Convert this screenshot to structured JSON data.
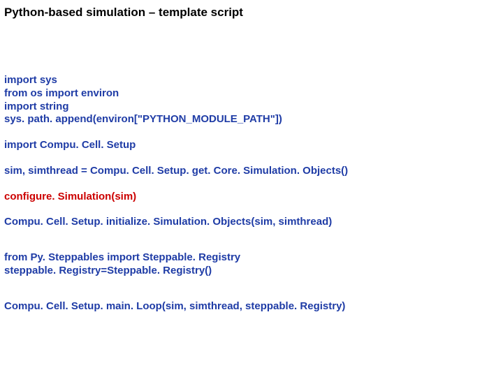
{
  "title": "Python-based simulation – template script",
  "code": {
    "l1": "import sys",
    "l2": "from os import environ",
    "l3": "import string",
    "l4": "sys. path. append(environ[\"PYTHON_MODULE_PATH\"])",
    "l5": "import Compu. Cell. Setup",
    "l6": "sim, simthread = Compu. Cell. Setup. get. Core. Simulation. Objects()",
    "l7": "configure. Simulation(sim)",
    "l8": "Compu. Cell. Setup. initialize. Simulation. Objects(sim, simthread)",
    "l9": "from Py. Steppables import Steppable. Registry",
    "l10": "steppable. Registry=Steppable. Registry()",
    "l11": "Compu. Cell. Setup. main. Loop(sim, simthread, steppable. Registry)"
  }
}
